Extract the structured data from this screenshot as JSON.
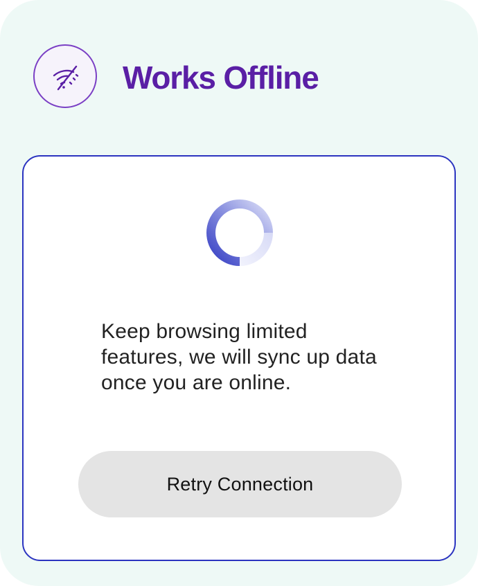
{
  "header": {
    "title": "Works Offline",
    "icon": "wifi-off-icon",
    "accent_color": "#5a1fa5"
  },
  "card": {
    "spinner_icon": "loading-spinner-icon",
    "message": "Keep browsing limited features, we will sync up data once you are online.",
    "retry_label": "Retry Connection",
    "border_color": "#2b34c0"
  },
  "colors": {
    "background": "#eef9f6",
    "button_background": "#e4e4e4",
    "spinner_color": "#2b34c0"
  }
}
